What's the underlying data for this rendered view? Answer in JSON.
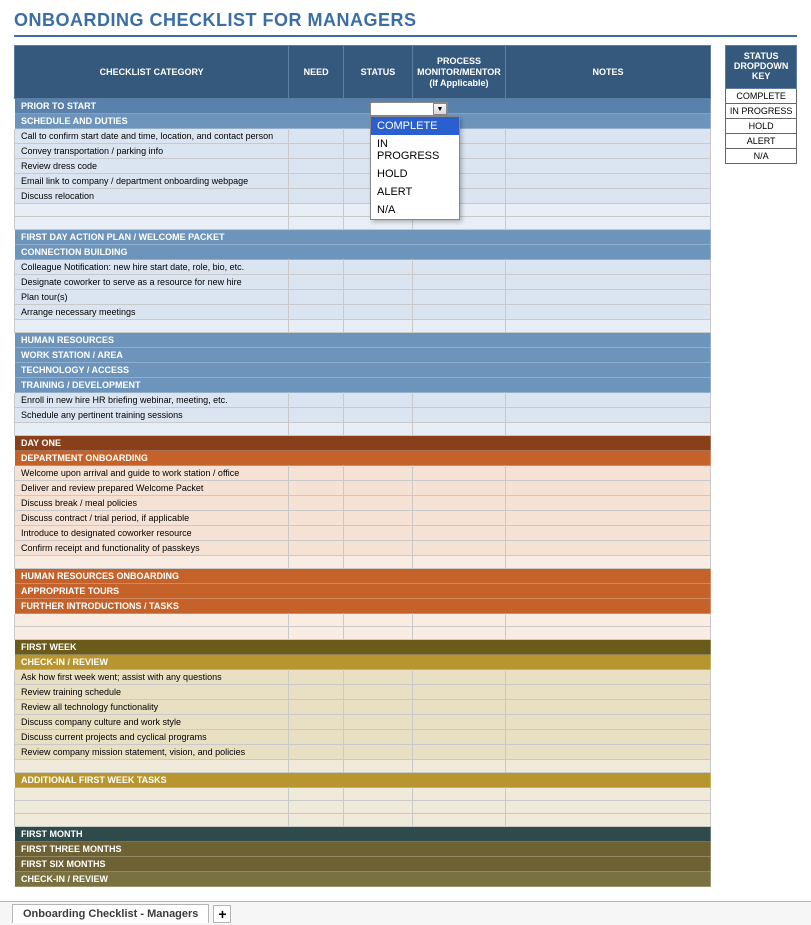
{
  "title": "ONBOARDING CHECKLIST FOR MANAGERS",
  "columns": {
    "category": "CHECKLIST CATEGORY",
    "need": "NEED",
    "status": "STATUS",
    "process": "PROCESS MONITOR/MENTOR (If Applicable)",
    "notes": "NOTES"
  },
  "sidebar": {
    "header": "STATUS DROPDOWN KEY",
    "items": [
      "COMPLETE",
      "IN PROGRESS",
      "HOLD",
      "ALERT",
      "N/A"
    ]
  },
  "dropdown": {
    "selected": "COMPLETE",
    "options": [
      "COMPLETE",
      "IN PROGRESS",
      "HOLD",
      "ALERT",
      "N/A"
    ]
  },
  "sections": {
    "prior_to_start": {
      "title": "PRIOR TO START",
      "groups": {
        "schedule_duties": {
          "title": "SCHEDULE AND DUTIES",
          "items": [
            "Call to confirm start date and time, location, and contact person",
            "Convey transportation / parking info",
            "Review dress code",
            "Email link to company / department onboarding webpage",
            "Discuss relocation"
          ]
        },
        "first_day_action": {
          "title": "FIRST DAY ACTION PLAN / WELCOME PACKET"
        },
        "connection_building": {
          "title": "CONNECTION BUILDING",
          "items": [
            "Colleague Notification: new hire start date, role, bio, etc.",
            "Designate coworker to serve as a resource for new hire",
            "Plan tour(s)",
            "Arrange necessary meetings"
          ]
        },
        "human_resources": {
          "title": "HUMAN RESOURCES"
        },
        "work_station": {
          "title": "WORK STATION / AREA"
        },
        "technology_access": {
          "title": "TECHNOLOGY / ACCESS"
        },
        "training_development": {
          "title": "TRAINING / DEVELOPMENT",
          "items": [
            "Enroll in new hire HR briefing webinar, meeting, etc.",
            "Schedule any pertinent training sessions"
          ]
        }
      }
    },
    "day_one": {
      "title": "DAY ONE",
      "groups": {
        "department_onboarding": {
          "title": "DEPARTMENT ONBOARDING",
          "items": [
            "Welcome upon arrival and guide to work station / office",
            "Deliver and review prepared Welcome Packet",
            "Discuss break / meal policies",
            "Discuss contract / trial period, if applicable",
            "Introduce to designated coworker resource",
            "Confirm receipt and functionality of passkeys"
          ]
        },
        "hr_onboarding": {
          "title": "HUMAN RESOURCES ONBOARDING"
        },
        "appropriate_tours": {
          "title": "APPROPRIATE TOURS"
        },
        "further_intro": {
          "title": "FURTHER INTRODUCTIONS / TASKS"
        }
      }
    },
    "first_week": {
      "title": "FIRST WEEK",
      "groups": {
        "checkin": {
          "title": "CHECK-IN / REVIEW",
          "items": [
            "Ask how first week went; assist with any questions",
            "Review training schedule",
            "Review all technology functionality",
            "Discuss company culture and work style",
            "Discuss current projects and cyclical programs",
            "Review company mission statement, vision, and policies"
          ]
        },
        "additional_tasks": {
          "title": "ADDITIONAL FIRST WEEK TASKS"
        }
      }
    },
    "first_month": {
      "title": "FIRST MONTH"
    },
    "first_three_months": {
      "title": "FIRST THREE MONTHS"
    },
    "first_six_months": {
      "title": "FIRST SIX MONTHS"
    },
    "checkin_review": {
      "title": "CHECK-IN / REVIEW"
    }
  },
  "tabs": {
    "active": "Onboarding Checklist - Managers",
    "add_glyph": "+"
  }
}
